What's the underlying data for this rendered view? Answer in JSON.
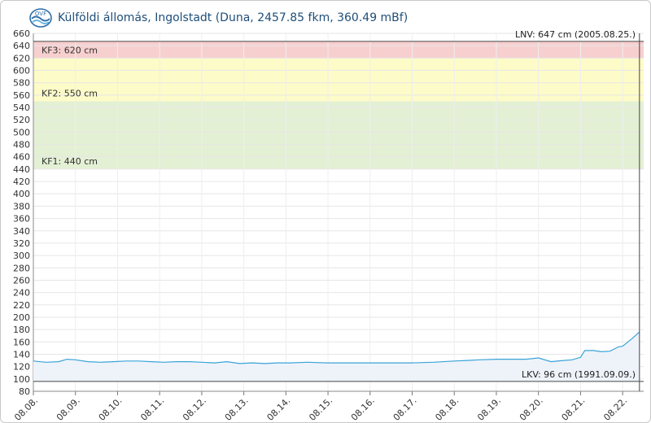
{
  "header": {
    "title": "Külföldi állomás, Ingolstadt (Duna, 2457.85 fkm, 360.49 mBf)",
    "logo_icon": "ovf-logo-icon"
  },
  "chart_data": {
    "type": "area",
    "title": "Külföldi állomás, Ingolstadt (Duna, 2457.85 fkm, 360.49 mBf)",
    "xlabel": "",
    "ylabel": "",
    "ylim": [
      80,
      660
    ],
    "yticks": [
      80,
      100,
      120,
      140,
      160,
      180,
      200,
      220,
      240,
      260,
      280,
      300,
      320,
      340,
      360,
      380,
      400,
      420,
      440,
      460,
      480,
      500,
      520,
      540,
      560,
      580,
      600,
      620,
      640,
      660
    ],
    "xlim": [
      0,
      14.5
    ],
    "xticks": [
      "08.08.",
      "08.09.",
      "08.10.",
      "08.11.",
      "08.12.",
      "08.13.",
      "08.14.",
      "08.15.",
      "08.16.",
      "08.17.",
      "08.18.",
      "08.19.",
      "08.20.",
      "08.21.",
      "08.22."
    ],
    "grid": true,
    "bands": [
      {
        "label": "KF1: 440 cm",
        "from": 440,
        "to": 550,
        "color": "#e4f0d4"
      },
      {
        "label": "KF2: 550 cm",
        "from": 550,
        "to": 620,
        "color": "#fdfbc8"
      },
      {
        "label": "KF3: 620 cm",
        "from": 620,
        "to": 647,
        "color": "#f8cfcf"
      }
    ],
    "reference_lines": [
      {
        "label": "LNV: 647 cm (2005.08.25.)",
        "value": 647
      },
      {
        "label": "LKV: 96 cm (1991.09.09.)",
        "value": 96
      }
    ],
    "series": [
      {
        "color": "#3aa3d8",
        "x": [
          0,
          0.3,
          0.6,
          0.8,
          1.0,
          1.3,
          1.6,
          1.9,
          2.2,
          2.5,
          2.8,
          3.1,
          3.4,
          3.7,
          4.0,
          4.3,
          4.6,
          4.9,
          5.2,
          5.5,
          5.8,
          6.1,
          6.5,
          7.0,
          7.5,
          8.0,
          8.5,
          9.0,
          9.5,
          10.0,
          10.3,
          10.6,
          11.0,
          11.4,
          11.7,
          12.0,
          12.3,
          12.6,
          12.8,
          13.0,
          13.1,
          13.3,
          13.5,
          13.7,
          13.9,
          14.0,
          14.2,
          14.4
        ],
        "y": [
          129,
          127,
          128,
          132,
          131,
          128,
          127,
          128,
          129,
          129,
          128,
          127,
          128,
          128,
          127,
          126,
          128,
          125,
          126,
          125,
          126,
          126,
          127,
          126,
          126,
          126,
          126,
          126,
          127,
          129,
          130,
          131,
          132,
          132,
          132,
          134,
          128,
          130,
          131,
          135,
          146,
          146,
          144,
          145,
          152,
          153,
          164,
          176
        ]
      }
    ],
    "crosshair_x": 14.4
  }
}
